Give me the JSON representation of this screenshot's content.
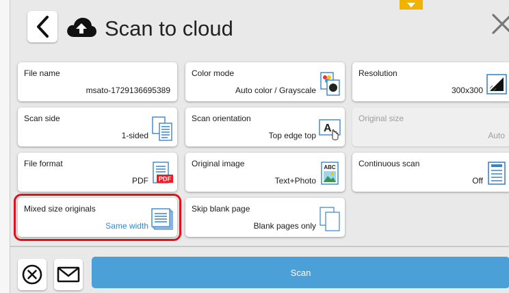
{
  "header": {
    "title": "Scan to cloud",
    "icons": {
      "back": "chevron-left-icon",
      "cloud": "cloud-upload-icon",
      "close": "close-icon",
      "tab": "down-arrow-icon"
    }
  },
  "settings": [
    {
      "label": "File name",
      "value": "msato-1729136695389",
      "icon": "",
      "enabled": true
    },
    {
      "label": "Color mode",
      "value": "Auto color / Grayscale",
      "icon": "color-mode-icon",
      "enabled": true
    },
    {
      "label": "Resolution",
      "value": "300x300",
      "icon": "resolution-icon",
      "enabled": true
    },
    {
      "label": "Scan side",
      "value": "1-sided",
      "icon": "pages-icon",
      "enabled": true
    },
    {
      "label": "Scan orientation",
      "value": "Top edge top",
      "icon": "orientation-icon",
      "enabled": true
    },
    {
      "label": "Original size",
      "value": "Auto",
      "icon": "",
      "enabled": false
    },
    {
      "label": "File format",
      "value": "PDF",
      "icon": "pdf-file-icon",
      "enabled": true
    },
    {
      "label": "Original image",
      "value": "Text+Photo",
      "icon": "text-photo-icon",
      "enabled": true
    },
    {
      "label": "Continuous scan",
      "value": "Off",
      "icon": "document-icon",
      "enabled": true
    },
    {
      "label": "Mixed size originals",
      "value": "Same width",
      "icon": "stacked-pages-icon",
      "enabled": true,
      "highlighted": true
    },
    {
      "label": "Skip blank page",
      "value": "Blank pages only",
      "icon": "blank-pages-icon",
      "enabled": true
    }
  ],
  "icon_text": {
    "pdf": "PDF",
    "abc": "ABC",
    "orientation_letter": "A"
  },
  "footer": {
    "scan_label": "Scan",
    "icons": {
      "reset": "reset-circle-x-icon",
      "mail": "envelope-icon"
    }
  },
  "colors": {
    "accent": "#4ca0d8",
    "highlight": "#e0101e",
    "handle": "#f0b400",
    "value_link": "#2a8ccc"
  }
}
